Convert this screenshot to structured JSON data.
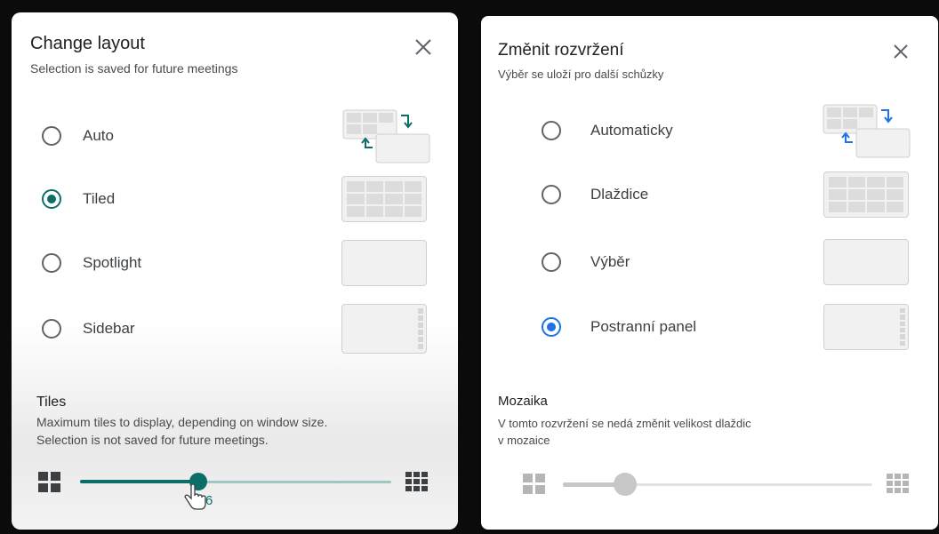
{
  "left": {
    "title": "Change layout",
    "subtitle": "Selection is saved for future meetings",
    "options": [
      {
        "label": "Auto",
        "selected": false,
        "thumb": "auto"
      },
      {
        "label": "Tiled",
        "selected": true,
        "thumb": "tiled"
      },
      {
        "label": "Spotlight",
        "selected": false,
        "thumb": "spotlight"
      },
      {
        "label": "Sidebar",
        "selected": false,
        "thumb": "sidebar"
      }
    ],
    "tiles_title": "Tiles",
    "tiles_desc_1": "Maximum tiles to display, depending on window size.",
    "tiles_desc_2": "Selection is not saved for future meetings.",
    "slider_value_label": "6",
    "slider_fraction": 0.38
  },
  "right": {
    "title": "Změnit rozvržení",
    "subtitle": "Výběr se uloží pro další schůzky",
    "options": [
      {
        "label": "Automaticky",
        "selected": false,
        "thumb": "auto"
      },
      {
        "label": "Dlaždice",
        "selected": false,
        "thumb": "tiled"
      },
      {
        "label": "Výběr",
        "selected": false,
        "thumb": "spotlight"
      },
      {
        "label": "Postranní panel",
        "selected": true,
        "thumb": "sidebar"
      }
    ],
    "tiles_title": "Mozaika",
    "tiles_desc_1": "V tomto rozvržení se nedá změnit velikost dlaždic",
    "tiles_desc_2": "v mozaice",
    "slider_fraction": 0.2,
    "slider_disabled": true
  },
  "icons": {
    "close": "close-icon",
    "few_tiles": "grid-2x2-icon",
    "many_tiles": "grid-3x3-icon",
    "cursor": "hand-pointer-icon"
  },
  "colors": {
    "accent_teal": "#0b6f68",
    "accent_blue": "#1a73e8",
    "disabled": "#c7c7c7"
  }
}
